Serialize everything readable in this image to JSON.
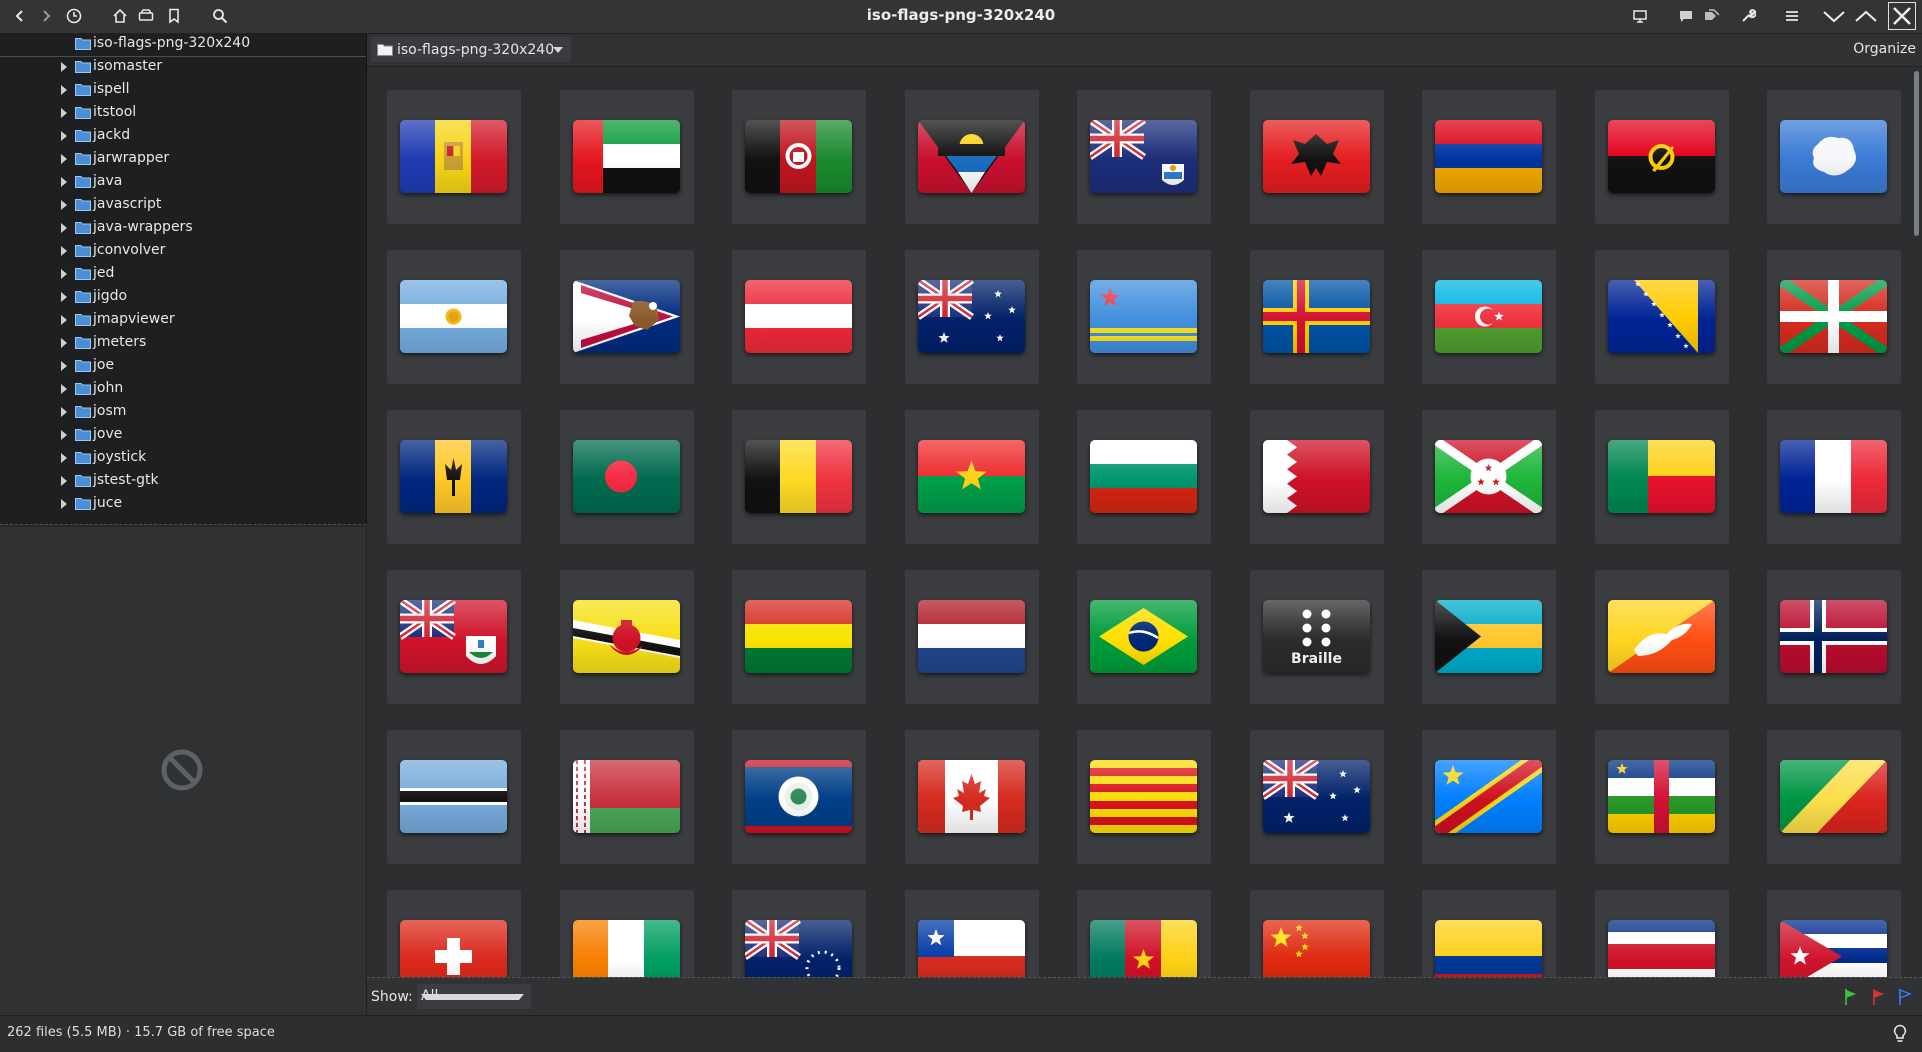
{
  "window": {
    "title": "iso-flags-png-320x240"
  },
  "tree": {
    "items": [
      {
        "label": "iso-flags-png-320x240",
        "selected": true,
        "expander": false
      },
      {
        "label": "isomaster"
      },
      {
        "label": "ispell"
      },
      {
        "label": "itstool"
      },
      {
        "label": "jackd"
      },
      {
        "label": "jarwrapper"
      },
      {
        "label": "java"
      },
      {
        "label": "javascript"
      },
      {
        "label": "java-wrappers"
      },
      {
        "label": "jconvolver"
      },
      {
        "label": "jed"
      },
      {
        "label": "jigdo"
      },
      {
        "label": "jmapviewer"
      },
      {
        "label": "jmeters"
      },
      {
        "label": "joe"
      },
      {
        "label": "john"
      },
      {
        "label": "josm"
      },
      {
        "label": "jove"
      },
      {
        "label": "joystick"
      },
      {
        "label": "jstest-gtk"
      },
      {
        "label": "juce"
      }
    ]
  },
  "location": {
    "path": "iso-flags-png-320x240",
    "organize_label": "Organize"
  },
  "filter": {
    "show_label": "Show:",
    "show_value": "All"
  },
  "status": {
    "text": "262 files (5.5  MB)  ·  15.7  GB of free space"
  },
  "icons": {
    "back": "back-icon",
    "forward": "forward-icon",
    "history": "clock-icon",
    "home": "home-icon",
    "drive": "drive-icon",
    "bookmark": "bookmark-icon",
    "search": "search-icon",
    "slideshow": "presentation-icon",
    "comment": "comment-icon",
    "tags": "tags-icon",
    "tools": "wrench-icon",
    "menu": "hamburger-menu-icon",
    "minimize": "chevron-down-icon",
    "maximize": "chevron-up-icon",
    "close": "close-icon"
  },
  "colors": {
    "accent_green": "#3cc23c",
    "accent_red": "#e03030",
    "accent_blue": "#3c78ff"
  },
  "flags": [
    {
      "name": "andorra"
    },
    {
      "name": "united-arab-emirates"
    },
    {
      "name": "afghanistan"
    },
    {
      "name": "antigua-and-barbuda"
    },
    {
      "name": "anguilla"
    },
    {
      "name": "albania"
    },
    {
      "name": "armenia"
    },
    {
      "name": "angola"
    },
    {
      "name": "antarctica"
    },
    {
      "name": "argentina"
    },
    {
      "name": "american-samoa"
    },
    {
      "name": "austria"
    },
    {
      "name": "australia"
    },
    {
      "name": "aruba"
    },
    {
      "name": "aland-islands"
    },
    {
      "name": "azerbaijan"
    },
    {
      "name": "bosnia-and-herzegovina"
    },
    {
      "name": "basque-country"
    },
    {
      "name": "barbados"
    },
    {
      "name": "bangladesh"
    },
    {
      "name": "belgium"
    },
    {
      "name": "burkina-faso"
    },
    {
      "name": "bulgaria"
    },
    {
      "name": "bahrain"
    },
    {
      "name": "burundi"
    },
    {
      "name": "benin"
    },
    {
      "name": "saint-barthelemy"
    },
    {
      "name": "bermuda"
    },
    {
      "name": "brunei"
    },
    {
      "name": "bolivia"
    },
    {
      "name": "bonaire"
    },
    {
      "name": "brazil"
    },
    {
      "name": "braille",
      "label": "Braille"
    },
    {
      "name": "bahamas"
    },
    {
      "name": "bhutan"
    },
    {
      "name": "bouvet-island"
    },
    {
      "name": "botswana"
    },
    {
      "name": "belarus"
    },
    {
      "name": "belize"
    },
    {
      "name": "canada"
    },
    {
      "name": "catalonia"
    },
    {
      "name": "cocos-islands"
    },
    {
      "name": "dr-congo"
    },
    {
      "name": "central-african-republic"
    },
    {
      "name": "congo"
    },
    {
      "name": "switzerland"
    },
    {
      "name": "ivory-coast"
    },
    {
      "name": "cook-islands"
    },
    {
      "name": "chile"
    },
    {
      "name": "cameroon"
    },
    {
      "name": "china"
    },
    {
      "name": "colombia"
    },
    {
      "name": "costa-rica"
    },
    {
      "name": "cuba"
    }
  ]
}
